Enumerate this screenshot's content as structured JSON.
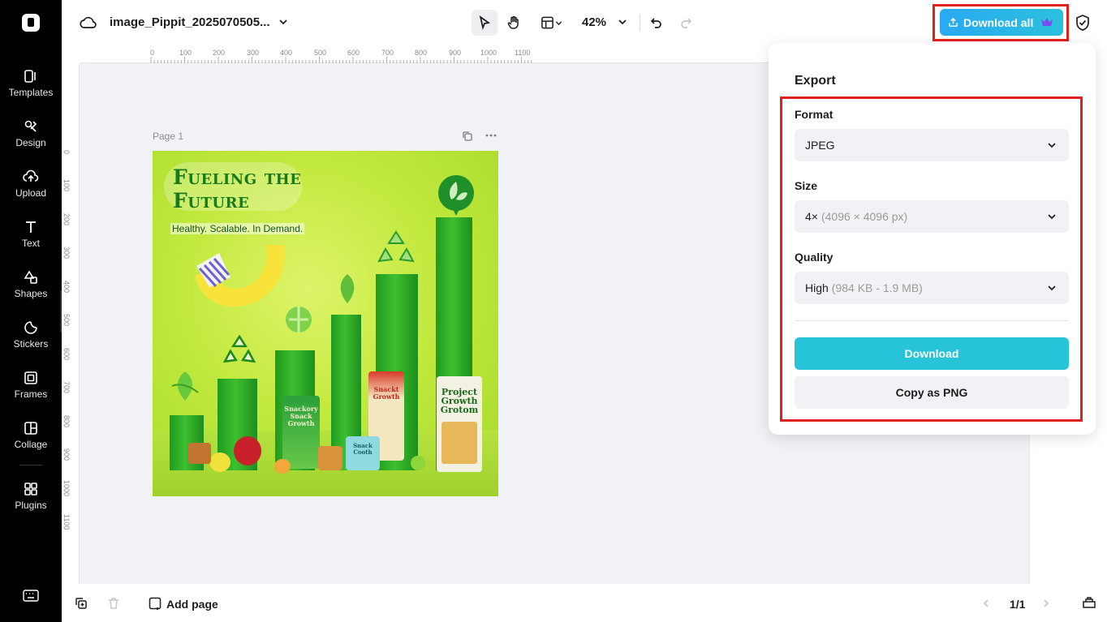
{
  "app": {
    "file_name": "image_Pippit_2025070505..."
  },
  "sidebar": {
    "items": [
      {
        "label": "Templates",
        "icon": "templates-icon"
      },
      {
        "label": "Design",
        "icon": "design-icon"
      },
      {
        "label": "Upload",
        "icon": "upload-icon"
      },
      {
        "label": "Text",
        "icon": "text-icon"
      },
      {
        "label": "Shapes",
        "icon": "shapes-icon"
      },
      {
        "label": "Stickers",
        "icon": "stickers-icon"
      },
      {
        "label": "Frames",
        "icon": "frames-icon"
      },
      {
        "label": "Collage",
        "icon": "collage-icon"
      },
      {
        "label": "Plugins",
        "icon": "plugins-icon"
      }
    ]
  },
  "toolbar": {
    "zoom": "42%",
    "download_all_label": "Download all",
    "active_tool": "select"
  },
  "ruler": {
    "top_ticks": [
      "0",
      "100",
      "200",
      "300",
      "400",
      "500",
      "600",
      "700",
      "800",
      "900",
      "1000",
      "1100"
    ],
    "left_ticks": [
      "0",
      "100",
      "200",
      "300",
      "400",
      "500",
      "600",
      "700",
      "800",
      "900",
      "1000",
      "1100"
    ]
  },
  "canvas": {
    "page_label": "Page 1",
    "artwork": {
      "headline_line1": "Fueling the",
      "headline_line2": "Future",
      "tagline": "Healthy. Scalable. In Demand.",
      "packages": [
        {
          "text": "Snackory Snack Growth"
        },
        {
          "text": "Snackt Growth"
        },
        {
          "text": "Snack Cooth"
        },
        {
          "text": "Project Growth Grotom"
        }
      ]
    }
  },
  "export": {
    "title": "Export",
    "format": {
      "label": "Format",
      "value": "JPEG"
    },
    "size": {
      "label": "Size",
      "value": "4×",
      "detail": "(4096 × 4096 px)"
    },
    "quality": {
      "label": "Quality",
      "value": "High",
      "detail": "(984 KB - 1.9 MB)"
    },
    "download_label": "Download",
    "copy_label": "Copy as PNG"
  },
  "bottom": {
    "add_page_label": "Add page",
    "page_counter": "1/1"
  },
  "colors": {
    "accent": "#27c3d9",
    "highlight_frame": "#e0201e",
    "sidebar_bg": "#000000"
  }
}
